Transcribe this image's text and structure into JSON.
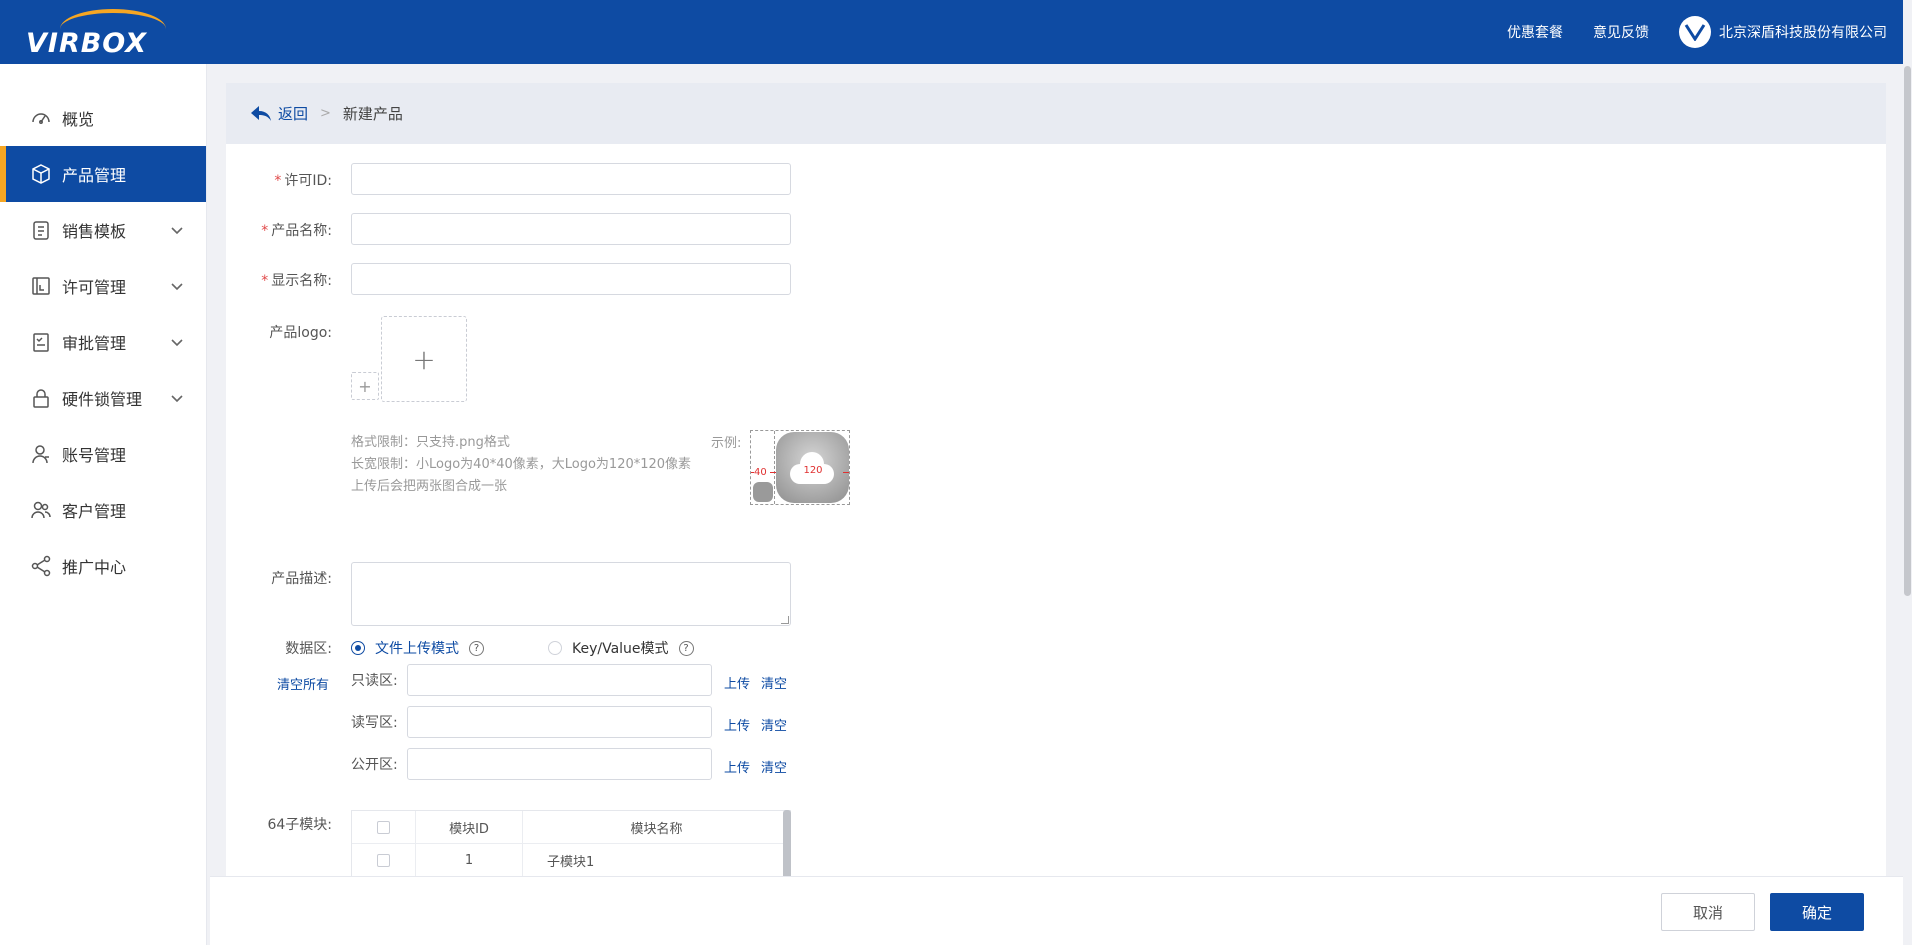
{
  "header": {
    "logo_text": "VIRBOX",
    "links": [
      "优惠套餐",
      "意见反馈"
    ],
    "company": "北京深盾科技股份有限公司"
  },
  "sidebar": {
    "items": [
      {
        "label": "概览",
        "icon": "dashboard-icon",
        "active": false,
        "expandable": false
      },
      {
        "label": "产品管理",
        "icon": "box-icon",
        "active": true,
        "expandable": false
      },
      {
        "label": "销售模板",
        "icon": "clipboard-icon",
        "active": false,
        "expandable": true
      },
      {
        "label": "许可管理",
        "icon": "license-icon",
        "active": false,
        "expandable": true
      },
      {
        "label": "审批管理",
        "icon": "approval-icon",
        "active": false,
        "expandable": true
      },
      {
        "label": "硬件锁管理",
        "icon": "lock-icon",
        "active": false,
        "expandable": true
      },
      {
        "label": "账号管理",
        "icon": "user-icon",
        "active": false,
        "expandable": false
      },
      {
        "label": "客户管理",
        "icon": "users-icon",
        "active": false,
        "expandable": false
      },
      {
        "label": "推广中心",
        "icon": "share-icon",
        "active": false,
        "expandable": false
      }
    ]
  },
  "breadcrumb": {
    "back": "返回",
    "current": "新建产品"
  },
  "form": {
    "license_id": {
      "label": "许可ID:",
      "value": ""
    },
    "product_name": {
      "label": "产品名称:",
      "value": ""
    },
    "display_name": {
      "label": "显示名称:",
      "value": ""
    },
    "logo": {
      "label": "产品logo:",
      "hints": [
        "格式限制：只支持.png格式",
        "长宽限制：小Logo为40*40像素，大Logo为120*120像素",
        "上传后会把两张图合成一张"
      ],
      "example_label": "示例:",
      "example_small": "40",
      "example_big": "120"
    },
    "description": {
      "label": "产品描述:",
      "value": ""
    },
    "data_area": {
      "label": "数据区:",
      "clear_all": "清空所有",
      "modes": [
        {
          "label": "文件上传模式",
          "selected": true
        },
        {
          "label": "Key/Value模式",
          "selected": false
        }
      ],
      "zones": [
        {
          "label": "只读区:",
          "value": ""
        },
        {
          "label": "读写区:",
          "value": ""
        },
        {
          "label": "公开区:",
          "value": ""
        }
      ],
      "upload_label": "上传",
      "clear_label": "清空"
    },
    "modules": {
      "label": "64子模块:",
      "columns": [
        "模块ID",
        "模块名称"
      ],
      "rows": [
        {
          "id": "1",
          "name": "子模块1"
        }
      ]
    }
  },
  "footer": {
    "cancel": "取消",
    "confirm": "确定"
  }
}
